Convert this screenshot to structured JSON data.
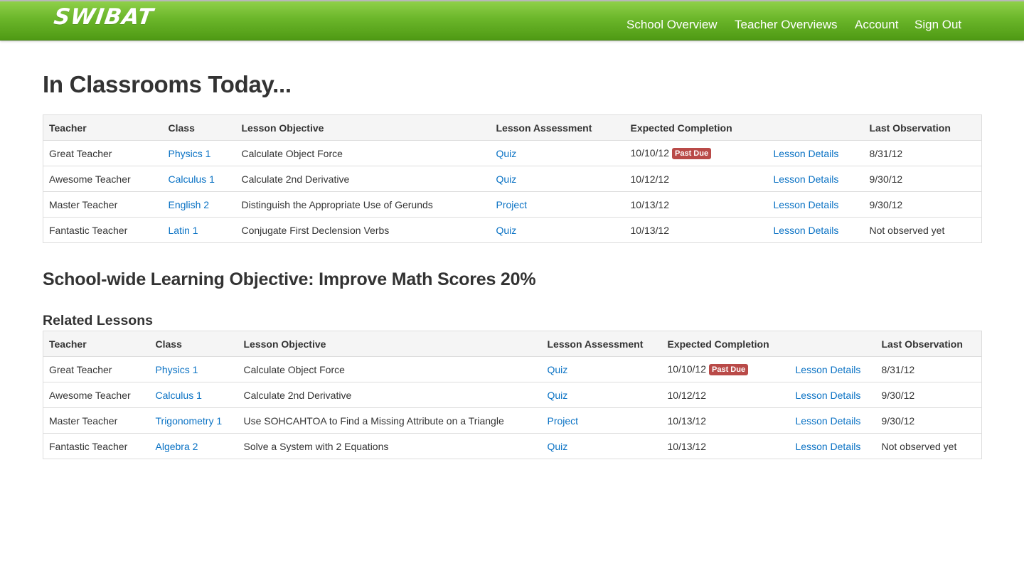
{
  "app": {
    "brand": "SWIBAT",
    "nav": [
      "School Overview",
      "Teacher Overviews",
      "Account",
      "Sign Out"
    ]
  },
  "colors": {
    "navbar": "#6bb62a",
    "link": "#0a72c4",
    "badge": "#b94a48"
  },
  "today": {
    "title": "In Classrooms Today...",
    "headers": [
      "Teacher",
      "Class",
      "Lesson Objective",
      "Lesson Assessment",
      "Expected Completion",
      "",
      "Last Observation"
    ],
    "rows": [
      {
        "teacher": "Great Teacher",
        "class": "Physics 1",
        "objective": "Calculate Object Force",
        "assessment": "Quiz",
        "completion": "10/10/12",
        "badge": "Past Due",
        "details": "Lesson Details",
        "observation": "8/31/12"
      },
      {
        "teacher": "Awesome Teacher",
        "class": "Calculus 1",
        "objective": "Calculate 2nd Derivative",
        "assessment": "Quiz",
        "completion": "10/12/12",
        "badge": "",
        "details": "Lesson Details",
        "observation": "9/30/12"
      },
      {
        "teacher": "Master Teacher",
        "class": "English 2",
        "objective": "Distinguish the Appropriate Use of Gerunds",
        "assessment": "Project",
        "completion": "10/13/12",
        "badge": "",
        "details": "Lesson Details",
        "observation": "9/30/12"
      },
      {
        "teacher": "Fantastic Teacher",
        "class": "Latin 1",
        "objective": "Conjugate First Declension Verbs",
        "assessment": "Quiz",
        "completion": "10/13/12",
        "badge": "",
        "details": "Lesson Details",
        "observation": "Not observed yet"
      }
    ]
  },
  "objective": {
    "title": "School-wide Learning Objective: Improve Math Scores 20%"
  },
  "related": {
    "title": "Related Lessons",
    "headers": [
      "Teacher",
      "Class",
      "Lesson Objective",
      "Lesson Assessment",
      "Expected Completion",
      "",
      "Last Observation"
    ],
    "rows": [
      {
        "teacher": "Great Teacher",
        "class": "Physics 1",
        "objective": "Calculate Object Force",
        "assessment": "Quiz",
        "completion": "10/10/12",
        "badge": "Past Due",
        "details": "Lesson Details",
        "observation": "8/31/12"
      },
      {
        "teacher": "Awesome Teacher",
        "class": "Calculus 1",
        "objective": "Calculate 2nd Derivative",
        "assessment": "Quiz",
        "completion": "10/12/12",
        "badge": "",
        "details": "Lesson Details",
        "observation": "9/30/12"
      },
      {
        "teacher": "Master Teacher",
        "class": "Trigonometry 1",
        "objective": "Use SOHCAHTOA to Find a Missing Attribute on a Triangle",
        "assessment": "Project",
        "completion": "10/13/12",
        "badge": "",
        "details": "Lesson Details",
        "observation": "9/30/12"
      },
      {
        "teacher": "Fantastic Teacher",
        "class": "Algebra 2",
        "objective": "Solve a System with 2 Equations",
        "assessment": "Quiz",
        "completion": "10/13/12",
        "badge": "",
        "details": "Lesson Details",
        "observation": "Not observed yet"
      }
    ]
  }
}
